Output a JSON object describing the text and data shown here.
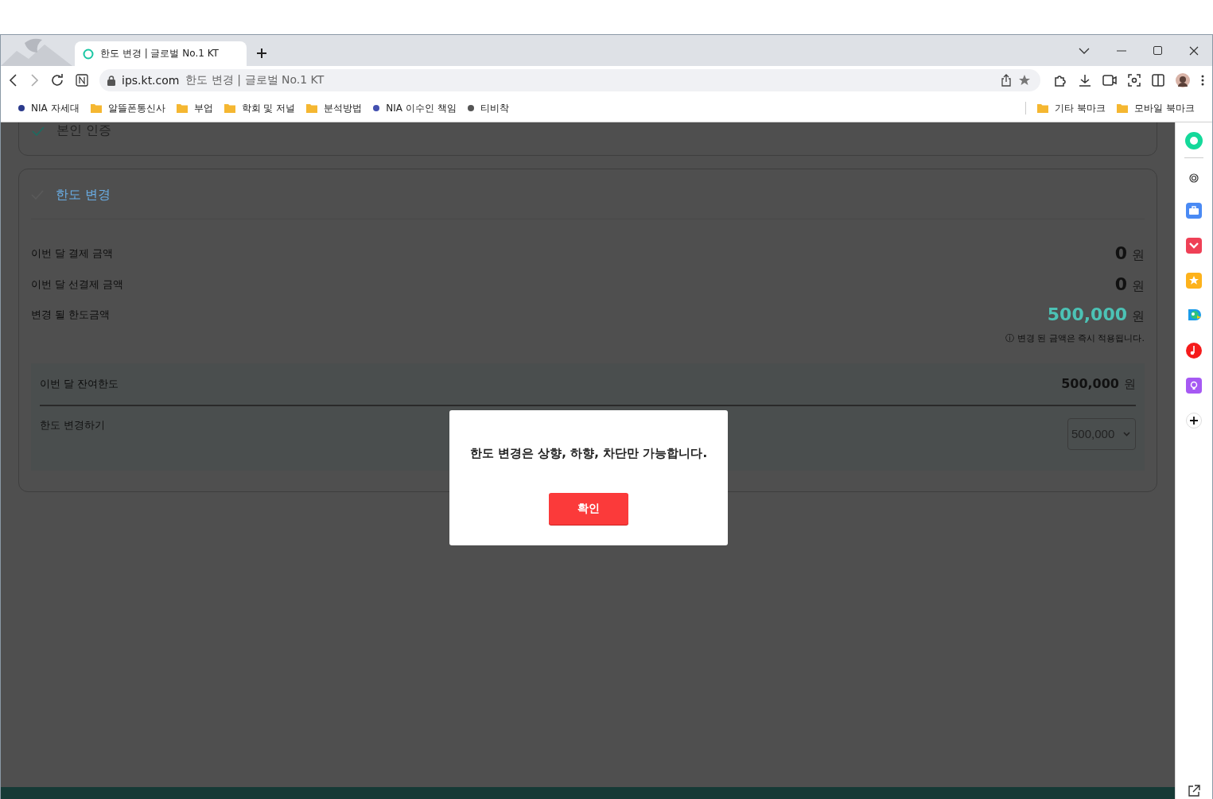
{
  "tab": {
    "title": "한도 변경 | 글로벌 No.1 KT",
    "selected": true
  },
  "address": {
    "domain": "ips.kt.com",
    "title": "한도 변경 | 글로벌 No.1 KT"
  },
  "bookmarks": [
    {
      "kind": "dot",
      "label": "NIA 자세대",
      "color": "#2b3a8c"
    },
    {
      "kind": "folder",
      "label": "알뜰폰통신사"
    },
    {
      "kind": "folder",
      "label": "부업"
    },
    {
      "kind": "folder",
      "label": "학회 및 저널"
    },
    {
      "kind": "folder",
      "label": "분석방법"
    },
    {
      "kind": "dot",
      "label": "NIA 이수인 책임",
      "color": "#4350b0"
    },
    {
      "kind": "dot",
      "label": "티비착",
      "color": "#555555"
    }
  ],
  "other_bookmarks": [
    {
      "kind": "folder",
      "label": "기타 북마크"
    },
    {
      "kind": "folder",
      "label": "모바일 북마크"
    }
  ],
  "verify_section": {
    "title": "본인 인증",
    "completed": true
  },
  "limit_section": {
    "title": "한도 변경",
    "completed": false,
    "rows": [
      {
        "label": "이번 달 결제 금액",
        "amount": "0",
        "unit": "원",
        "highlight": false
      },
      {
        "label": "이번 달 선결제 금액",
        "amount": "0",
        "unit": "원",
        "highlight": false
      },
      {
        "label": "변경 될 한도금액",
        "amount": "500,000",
        "unit": "원",
        "highlight": true
      }
    ],
    "note": "ⓘ 변경 된 금액은 즉시 적용됩니다.",
    "remaining": {
      "label": "이번 달 잔여한도",
      "amount": "500,000",
      "unit": "원"
    },
    "change": {
      "label": "한도 변경하기",
      "value": "500,000"
    }
  },
  "dialog": {
    "message": "한도 변경은 상향, 하향, 차단만 가능합니다.",
    "button": "확인"
  }
}
